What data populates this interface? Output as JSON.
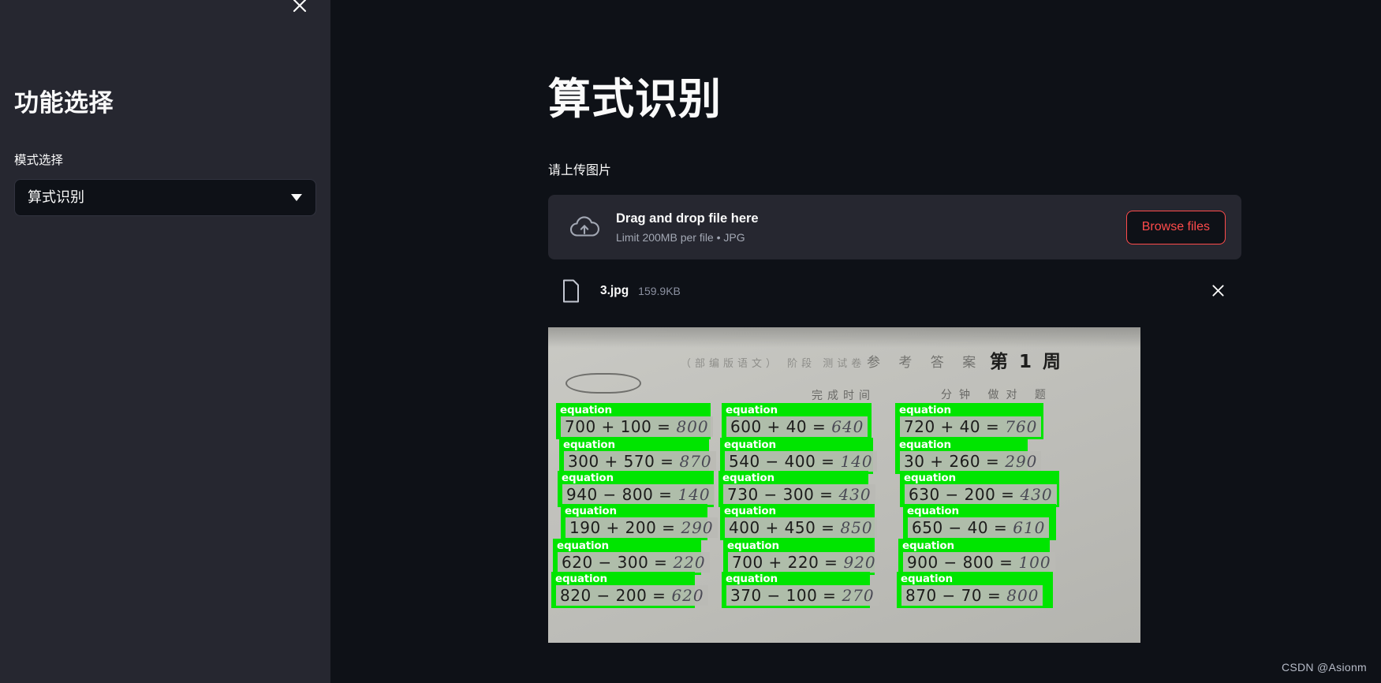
{
  "sidebar": {
    "close_icon": "close-icon",
    "title": "功能选择",
    "mode_label": "模式选择",
    "mode_value": "算式识别",
    "mode_options": [
      "算式识别"
    ],
    "caret_icon": "chevron-down-icon",
    "bg_color": "#262730"
  },
  "main": {
    "page_title": "算式识别",
    "upload_label": "请上传图片",
    "dropzone": {
      "icon": "cloud-upload-icon",
      "title": "Drag and drop file here",
      "subtitle": "Limit 200MB per file • JPG",
      "browse_label": "Browse files",
      "browse_border_color": "#ff4b4b",
      "browse_text_color": "#ff4b4b",
      "bg_color": "#262730"
    },
    "file": {
      "icon": "document-icon",
      "name": "3.jpg",
      "size": "159.9KB",
      "remove_icon": "close-icon"
    }
  },
  "preview": {
    "worksheet": {
      "header_faint": "（部编版语文） 阶段 测试卷",
      "header_faint2": "参 考 答 案",
      "week_title": "第 1 周",
      "subline": "完成时间",
      "subline2": "分钟 做对 题",
      "detection_label": "equation",
      "detection_color": "#00e500",
      "columns": [
        {
          "equations": [
            {
              "printed": "700 + 100 =",
              "answer": "800"
            },
            {
              "printed": "300 + 570 =",
              "answer": "870"
            },
            {
              "printed": "940 − 800 =",
              "answer": "140"
            },
            {
              "printed": "190 + 200 =",
              "answer": "290"
            },
            {
              "printed": "620 − 300 =",
              "answer": "220"
            },
            {
              "printed": "820 − 200 =",
              "answer": "620"
            }
          ]
        },
        {
          "equations": [
            {
              "printed": "600 + 40 =",
              "answer": "640"
            },
            {
              "printed": "540 − 400 =",
              "answer": "140"
            },
            {
              "printed": "730 − 300 =",
              "answer": "430"
            },
            {
              "printed": "400 + 450 =",
              "answer": "850"
            },
            {
              "printed": "700 + 220 =",
              "answer": "920"
            },
            {
              "printed": "370 − 100 =",
              "answer": "270"
            }
          ]
        },
        {
          "equations": [
            {
              "printed": "720 + 40 =",
              "answer": "760"
            },
            {
              "printed": "30 + 260 =",
              "answer": "290"
            },
            {
              "printed": "630 − 200 =",
              "answer": "430"
            },
            {
              "printed": "650 − 40 =",
              "answer": "610"
            },
            {
              "printed": "900 − 800 =",
              "answer": "100"
            },
            {
              "printed": "870 − 70 =",
              "answer": "800"
            }
          ]
        }
      ]
    }
  },
  "watermark": "CSDN @Asionm"
}
